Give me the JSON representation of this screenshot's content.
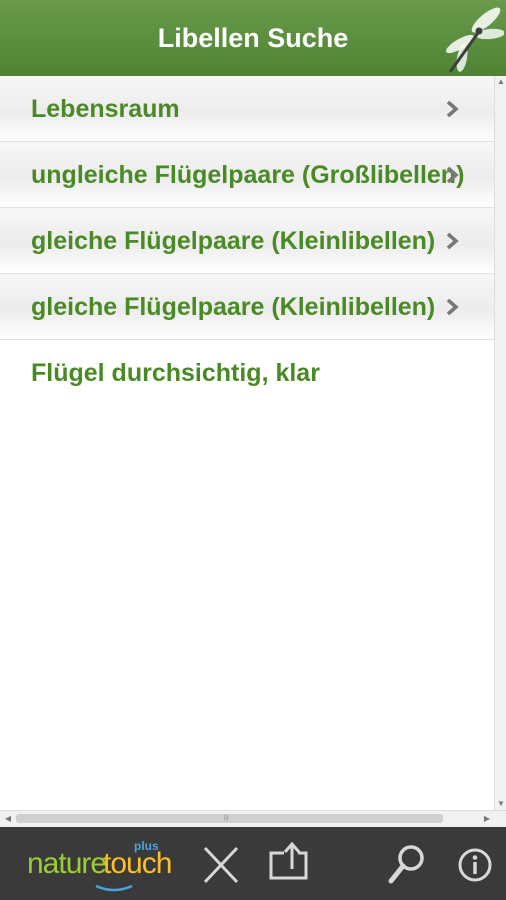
{
  "header": {
    "title": "Libellen Suche",
    "logo_icon": "dragonfly-icon"
  },
  "menu": {
    "items": [
      {
        "label": "Lebensraum",
        "has_chevron": true
      },
      {
        "label": "ungleiche Flügelpaare (Großlibellen)",
        "has_chevron": true
      },
      {
        "label": "gleiche Flügelpaare (Kleinlibellen)",
        "has_chevron": true
      },
      {
        "label": "gleiche Flügelpaare (Kleinlibellen)",
        "has_chevron": true
      },
      {
        "label": "Flügel durchsichtig, klar",
        "has_chevron": false
      }
    ]
  },
  "toolbar": {
    "brand_part1": "nature",
    "brand_part2": "touch",
    "brand_plus": "plus",
    "icons": [
      "close-icon",
      "share-icon",
      "search-icon",
      "info-icon"
    ]
  },
  "colors": {
    "header_green": "#5a8f3c",
    "text_green": "#4a8a25",
    "toolbar": "#3a3a3a"
  }
}
